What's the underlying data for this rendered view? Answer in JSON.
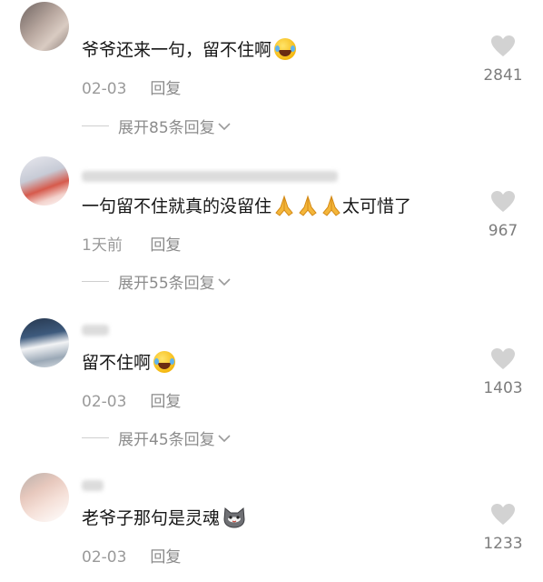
{
  "comments": [
    {
      "text": "爷爷还来一句，留不住啊",
      "emoji": "rolling-laughing-emoji",
      "date": "02-03",
      "reply_label": "回复",
      "expand_label": "展开85条回复",
      "likes": "2841"
    },
    {
      "text": "一句留不住就真的没留住",
      "emoji": "folded-hands-emoji",
      "text_after": "太可惜了",
      "date": "1天前",
      "reply_label": "回复",
      "expand_label": "展开55条回复",
      "likes": "967"
    },
    {
      "text": "留不住啊",
      "emoji": "crying-laughing-emoji",
      "date": "02-03",
      "reply_label": "回复",
      "expand_label": "展开45条回复",
      "likes": "1403"
    },
    {
      "text": "老爷子那句是灵魂",
      "emoji": "cat-face-emoji",
      "date": "02-03",
      "reply_label": "回复",
      "likes": "1233"
    }
  ],
  "colors": {
    "text": "#161616",
    "meta": "#9a9a9a",
    "heart": "#d2d2d2",
    "background": "#ffffff"
  }
}
